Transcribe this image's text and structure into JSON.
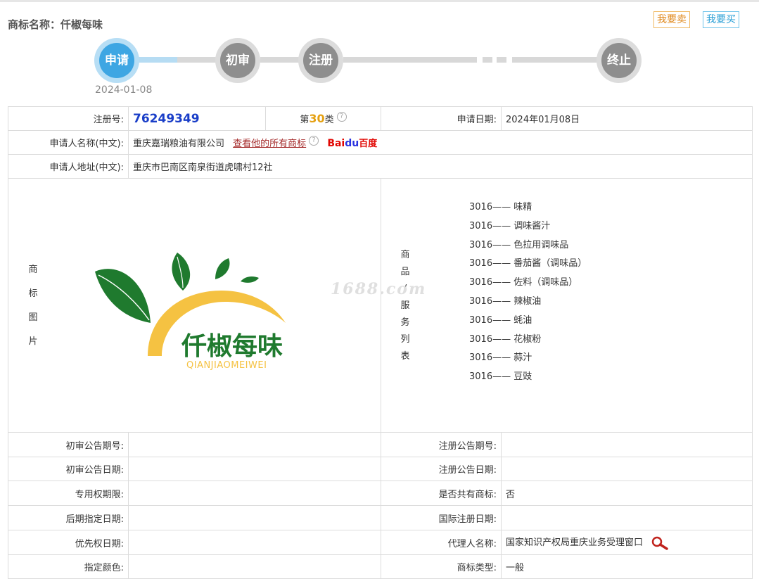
{
  "header": {
    "title_label": "商标名称：",
    "title_value": "仟椒每味",
    "sell_button": "我要卖",
    "buy_button": "我要买"
  },
  "progress": {
    "steps": [
      {
        "label": "申请",
        "active": true
      },
      {
        "label": "初审",
        "active": false
      },
      {
        "label": "注册",
        "active": false
      },
      {
        "label": "终止",
        "active": false
      }
    ],
    "date": "2024-01-08"
  },
  "info": {
    "reg_no_label": "注册号:",
    "reg_no": "76249349",
    "class_prefix": "第",
    "class_num": "30",
    "class_suffix": "类",
    "apply_date_label": "申请日期:",
    "apply_date": "2024年01月08日",
    "applicant_label": "申请人名称(中文):",
    "applicant": "重庆嘉瑞粮油有限公司",
    "view_all_link": "查看他的所有商标",
    "baidu_bai": "Bai",
    "baidu_paw": "du",
    "baidu_du": "百度",
    "address_label": "申请人地址(中文):",
    "address": "重庆市巴南区南泉街道虎啸村12社",
    "image_label_chars": [
      "商",
      "标",
      "图",
      "片"
    ],
    "goods_label_chars": [
      "商",
      "品",
      "/",
      "服",
      "务",
      "列",
      "表"
    ],
    "logo_cn": "仟椒每味",
    "logo_pinyin": "QIANJIAOMEIWEI",
    "goods": [
      "3016—— 味精",
      "3016—— 调味酱汁",
      "3016—— 色拉用调味品",
      "3016—— 番茄酱（调味品）",
      "3016—— 佐料（调味品）",
      "3016—— 辣椒油",
      "3016—— 蚝油",
      "3016—— 花椒粉",
      "3016—— 蒜汁",
      "3016—— 豆豉"
    ],
    "watermark": "1688.com",
    "prelim_no_label": "初审公告期号:",
    "reg_notice_no_label": "注册公告期号:",
    "prelim_date_label": "初审公告日期:",
    "reg_notice_date_label": "注册公告日期:",
    "exclusive_label": "专用权期限:",
    "shared_label": "是否共有商标:",
    "shared_value": "否",
    "later_date_label": "后期指定日期:",
    "intl_date_label": "国际注册日期:",
    "priority_label": "优先权日期:",
    "agent_label": "代理人名称:",
    "agent_value": "国家知识产权局重庆业务受理窗口",
    "color_label": "指定颜色:",
    "type_label": "商标类型:",
    "type_value": "一般"
  },
  "colors": {
    "active_step": "#3ea6e3",
    "inactive_step": "#8e8e8e",
    "reg_no": "#1a3ec8",
    "class_num": "#e5a113",
    "link": "#a52a2a",
    "logo_green": "#1f7a2e",
    "logo_yellow": "#f5c242"
  }
}
